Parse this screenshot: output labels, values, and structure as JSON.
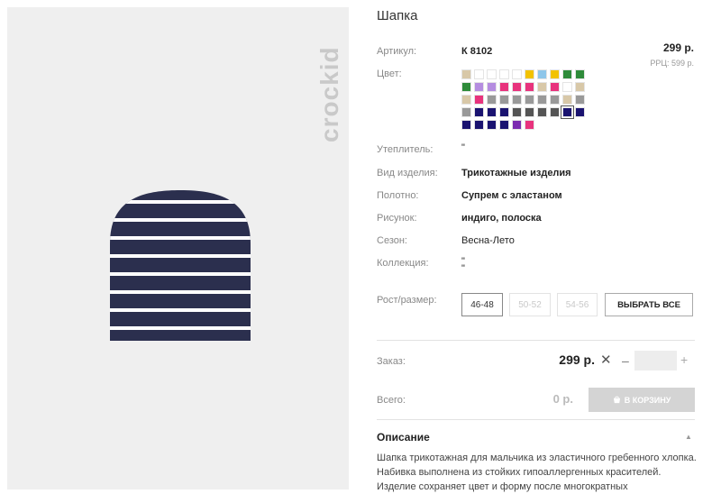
{
  "brand": "crockid",
  "product": {
    "title": "Шапка",
    "price": "299 р.",
    "rrp": "РРЦ: 599 р."
  },
  "labels": {
    "article": "Артикул:",
    "color": "Цвет:",
    "insulation": "Утеплитель:",
    "item_type": "Вид изделия:",
    "fabric": "Полотно:",
    "pattern": "Рисунок:",
    "season": "Сезон:",
    "collection": "Коллекция:",
    "size": "Рост/размер:",
    "order": "Заказ:",
    "total": "Всего:"
  },
  "values": {
    "article": "К 8102",
    "insulation": "\"",
    "item_type": "Трикотажные изделия",
    "fabric": "Супрем с эластаном",
    "pattern": "индиго, полоска",
    "season": "Весна-Лето",
    "collection_1": "\"",
    "collection_2": "\""
  },
  "swatches": [
    "#d8c8a8",
    "#ffffff",
    "#ffffff",
    "#ffffff",
    "#ffffff",
    "#f2c200",
    "#8ec6ea",
    "#f2c200",
    "#2e8b3a",
    "#2e8b3a",
    "#2e8b3a",
    "#b58de0",
    "#b58de0",
    "#e8337d",
    "#e8337d",
    "#e8337d",
    "#d8c8a8",
    "#e8337d",
    "#ffffff",
    "#d8c8a8",
    "#d8c8a8",
    "#e8337d",
    "#999999",
    "#999999",
    "#999999",
    "#999999",
    "#999999",
    "#999999",
    "#d8c8a8",
    "#999999",
    "#999999",
    "#1a1370",
    "#1a1370",
    "#1a1370",
    "#555555",
    "#555555",
    "#555555",
    "#555555",
    "#1a1370",
    "#1a1370",
    "#1a1370",
    "#1a1370",
    "#1a1370",
    "#1a1370",
    "#7b2bb0",
    "#e8337d"
  ],
  "selected_swatch_index": 38,
  "sizes": [
    {
      "label": "46-48",
      "available": true
    },
    {
      "label": "50-52",
      "available": false
    },
    {
      "label": "54-56",
      "available": false
    }
  ],
  "select_all_label": "ВЫБРАТЬ ВСЕ",
  "order": {
    "price": "299 р.",
    "times": "✕",
    "minus": "–",
    "plus": "+",
    "quantity_value": ""
  },
  "total": {
    "value": "0 р.",
    "cart_label": "В КОРЗИНУ"
  },
  "description": {
    "title": "Описание",
    "text": "Шапка трикотажная для мальчика из эластичного гребенного хлопка. Набивка выполнена из стойких гипоаллергенных красителей. Изделие сохраняет цвет и форму после многократных"
  },
  "colors": {
    "hat_navy": "#2b2f4e",
    "hat_stripe": "#ffffff",
    "cart_button": "#d4d4d4"
  }
}
